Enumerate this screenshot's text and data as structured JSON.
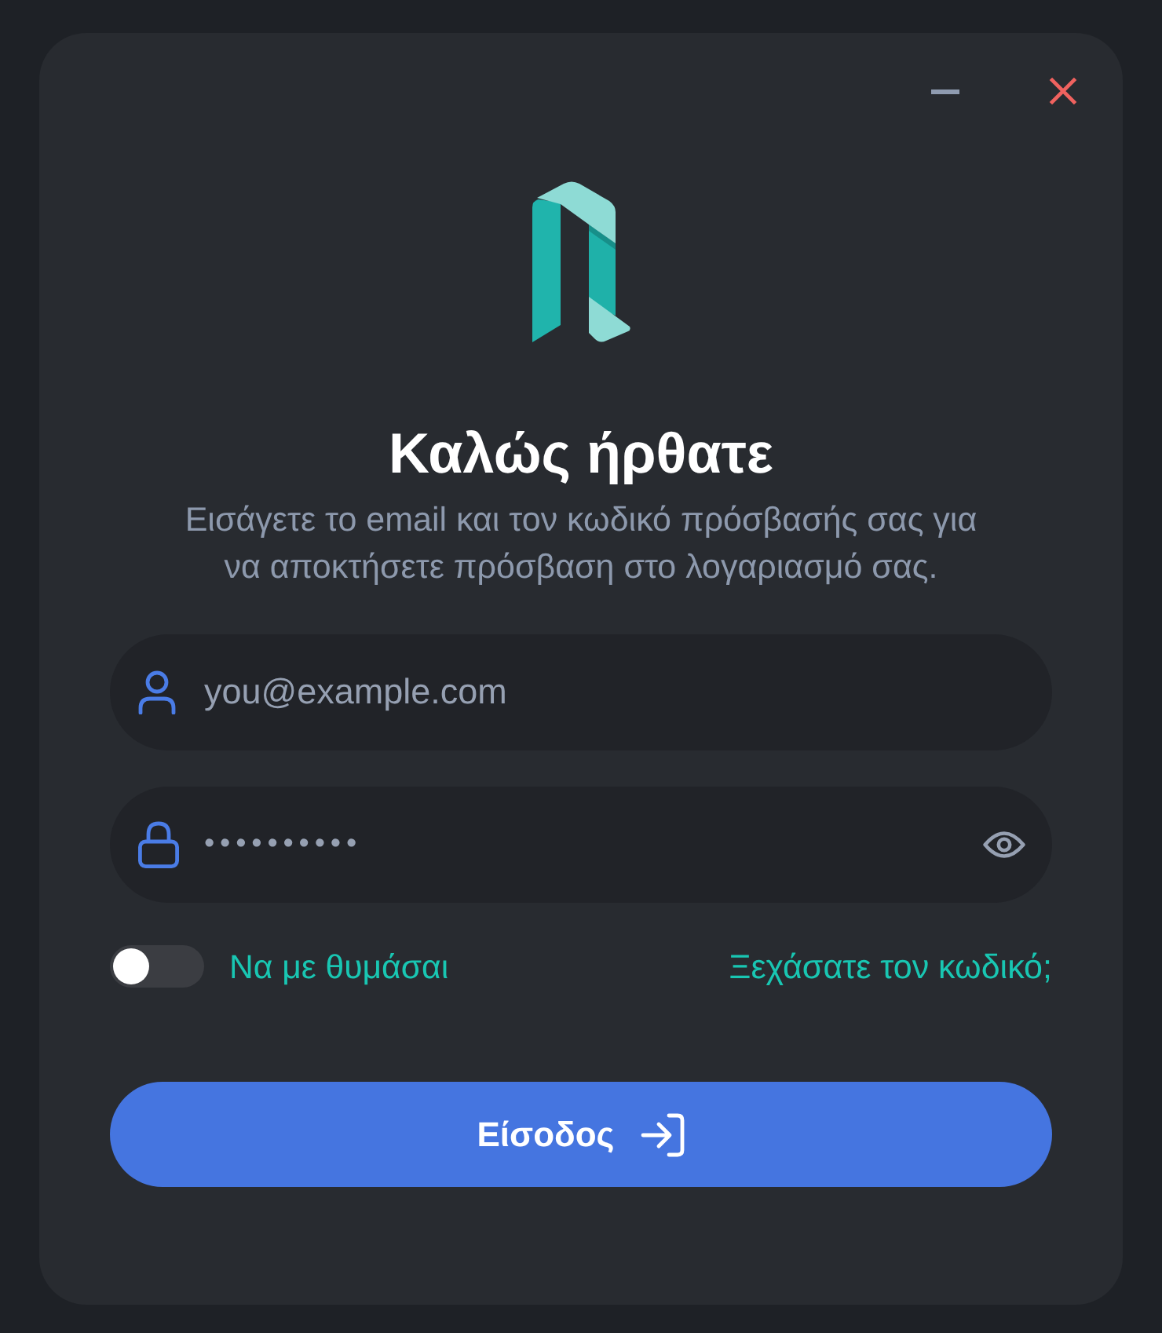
{
  "window": {
    "controls": [
      {
        "kind": "minimize"
      },
      {
        "kind": "close"
      }
    ]
  },
  "header": {
    "title": "Καλώς ήρθατε",
    "subtitle": "Εισάγετε το email και τον κωδικό πρόσβασής σας για να αποκτήσετε πρόσβαση στο λογαριασμό σας."
  },
  "fields": [
    {
      "kind": "email",
      "placeholder": "you@example.com"
    },
    {
      "kind": "password",
      "value": "••••••••••",
      "reveal_toggle": true
    }
  ],
  "remember": {
    "label": "Να με θυμάσαι",
    "on": false
  },
  "forgot_link": "Ξεχάσατε τον κωδικό;",
  "submit": {
    "label": "Είσοδος"
  }
}
